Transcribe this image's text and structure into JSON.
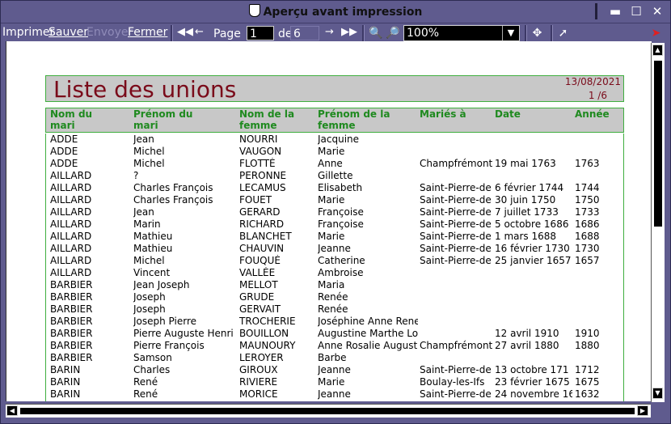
{
  "window": {
    "title": "Aperçu avant impression"
  },
  "toolbar": {
    "print": "Imprimer",
    "save": "Sauver",
    "send": "Envoyer",
    "close": "Fermer",
    "page_label": "Page",
    "page_current": "1",
    "page_of": "de",
    "page_total": "6",
    "zoom": "100%"
  },
  "report": {
    "title": "Liste des unions",
    "date": "13/08/2021",
    "page": "1 /6",
    "columns": [
      "Nom du mari",
      "Prénom du mari",
      "Nom de la femme",
      "Prénom de la femme",
      "Mariés à",
      "Date",
      "Année"
    ],
    "rows": [
      [
        "ADDE",
        "Jean",
        "NOURRI",
        "Jacquine",
        "",
        "",
        ""
      ],
      [
        "ADDE",
        "Michel",
        "VAUGON",
        "Marie",
        "",
        "",
        ""
      ],
      [
        "ADDE",
        "Michel",
        "FLOTTÉ",
        "Anne",
        "Champfrémont",
        "19 mai 1763",
        "1763"
      ],
      [
        "AILLARD",
        "?",
        "PERONNE",
        "Gillette",
        "",
        "",
        ""
      ],
      [
        "AILLARD",
        "Charles François",
        "LECAMUS",
        "Elisabeth",
        "Saint-Pierre-de",
        "6 février 1744",
        "1744"
      ],
      [
        "AILLARD",
        "Charles François",
        "FOUET",
        "Marie",
        "Saint-Pierre-de",
        "30 juin 1750",
        "1750"
      ],
      [
        "AILLARD",
        "Jean",
        "GERARD",
        "Françoise",
        "Saint-Pierre-de",
        "7 juillet 1733",
        "1733"
      ],
      [
        "AILLARD",
        "Marin",
        "RICHARD",
        "Françoise",
        "Saint-Pierre-de",
        "5 octobre 1686",
        "1686"
      ],
      [
        "AILLARD",
        "Mathieu",
        "BLANCHET",
        "Marie",
        "Saint-Pierre-de",
        "1 mars 1688",
        "1688"
      ],
      [
        "AILLARD",
        "Mathieu",
        "CHAUVIN",
        "Jeanne",
        "Saint-Pierre-de",
        "16 février 1730",
        "1730"
      ],
      [
        "AILLARD",
        "Michel",
        "FOUQUÉ",
        "Catherine",
        "Saint-Pierre-de",
        "25 janvier 1657",
        "1657"
      ],
      [
        "AILLARD",
        "Vincent",
        "VALLÉE",
        "Ambroise",
        "",
        "",
        ""
      ],
      [
        "BARBIER",
        "Jean Joseph",
        "MELLOT",
        "Maria",
        "",
        "",
        ""
      ],
      [
        "BARBIER",
        "Joseph",
        "GRUDE",
        "Renée",
        "",
        "",
        ""
      ],
      [
        "BARBIER",
        "Joseph",
        "GERVAIT",
        "Renée",
        "",
        "",
        ""
      ],
      [
        "BARBIER",
        "Joseph Pierre",
        "TROCHERIE",
        "Joséphine Anne Rene",
        "",
        "",
        ""
      ],
      [
        "BARBIER",
        "Pierre Auguste Henri",
        "BOUILLON",
        "Augustine Marthe Lo",
        "",
        "12 avril 1910",
        "1910"
      ],
      [
        "BARBIER",
        "Pierre François",
        "MAUNOURY",
        "Anne Rosalie August",
        "Champfrémont",
        "27 avril 1880",
        "1880"
      ],
      [
        "BARBIER",
        "Samson",
        "LEROYER",
        "Barbe",
        "",
        "",
        ""
      ],
      [
        "BARIN",
        "Charles",
        "GIROUX",
        "Jeanne",
        "Saint-Pierre-de",
        "13 octobre 171",
        "1712"
      ],
      [
        "BARIN",
        "René",
        "RIVIERE",
        "Marie",
        "Boulay-les-Ifs",
        "23 février 1675",
        "1675"
      ],
      [
        "BARIN",
        "René",
        "MORICE",
        "Jeanne",
        "Saint-Pierre-de",
        "24 novembre 16",
        "1632"
      ]
    ]
  }
}
